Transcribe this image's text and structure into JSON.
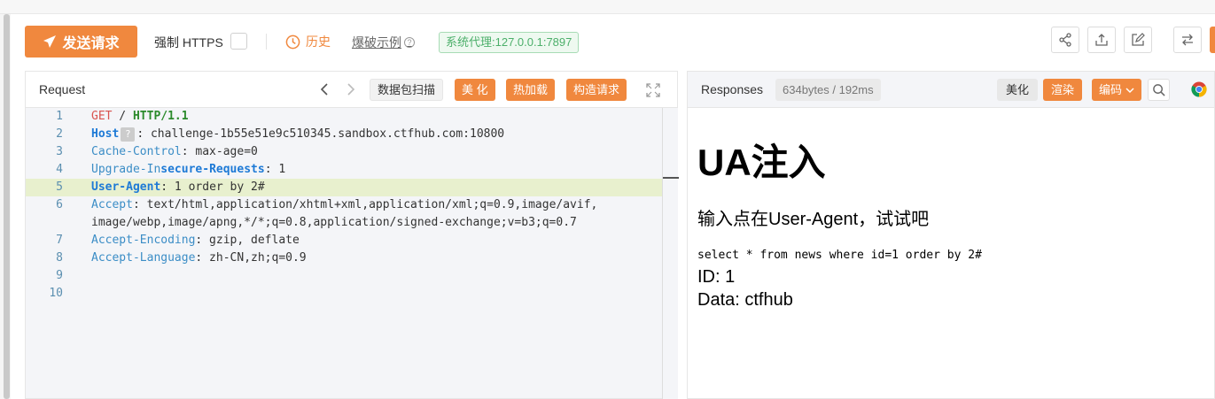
{
  "toolbar": {
    "send_label": "发送请求",
    "https_label": "强制 HTTPS",
    "history_label": "历史",
    "blast_label": "爆破示例",
    "help_mark": "?",
    "proxy_label": "系统代理:127.0.0.1:7897",
    "icons": [
      "share-icon",
      "upload-icon",
      "edit-icon",
      "swap-icon"
    ]
  },
  "request": {
    "title": "Request",
    "scan_label": "数据包扫描",
    "beautify_label": "美 化",
    "hotload_label": "热加载",
    "build_label": "构造请求",
    "lines": [
      {
        "no": "1",
        "parts": [
          [
            "GET",
            "k-red"
          ],
          [
            " / ",
            "dot-sep"
          ],
          [
            "HTTP/1.1",
            "k-green"
          ]
        ]
      },
      {
        "no": "2",
        "parts": [
          [
            "Host",
            "k-blue"
          ],
          [
            "?",
            "qbox"
          ],
          [
            ": challenge-1b55e51e9c510345.sandbox.ctfhub.com:10800",
            ""
          ]
        ]
      },
      {
        "no": "3",
        "parts": [
          [
            "Cache-Control",
            "k-light"
          ],
          [
            ": max-age=0",
            ""
          ]
        ]
      },
      {
        "no": "4",
        "parts": [
          [
            "Upgrade-In",
            "k-light"
          ],
          [
            "secure-Requests",
            "k-blue"
          ],
          [
            ": 1",
            ""
          ]
        ]
      },
      {
        "no": "5",
        "parts": [
          [
            "User-Agent",
            "k-blue"
          ],
          [
            ": 1 order by 2#",
            ""
          ]
        ]
      },
      {
        "no": "6",
        "parts": [
          [
            "Accept",
            "k-light"
          ],
          [
            ": text/html,application/xhtml+xml,application/xml;q=0.9,image/avif,",
            ""
          ]
        ]
      },
      {
        "no": "",
        "parts": [
          [
            "image/webp,image/apng,*/*;q=0.8,application/signed-exchange;v=b3;q=0.7",
            ""
          ]
        ]
      },
      {
        "no": "7",
        "parts": [
          [
            "Accept-Encoding",
            "k-light"
          ],
          [
            ": gzip, deflate",
            ""
          ]
        ]
      },
      {
        "no": "8",
        "parts": [
          [
            "Accept-Language",
            "k-light"
          ],
          [
            ": zh-CN,zh;q=0.9",
            ""
          ]
        ]
      },
      {
        "no": "9",
        "parts": []
      },
      {
        "no": "10",
        "parts": []
      }
    ],
    "highlight_line_index": 4
  },
  "response": {
    "title": "Responses",
    "size_badge": "634bytes / 192ms",
    "beautify_label": "美化",
    "render_label": "渲染",
    "encode_label": "编码",
    "page": {
      "heading": "UA注入",
      "subtitle": "输入点在User-Agent，试试吧",
      "sql": "select * from news where id=1 order by 2#",
      "id_line": "ID: 1",
      "data_line": "Data: ctfhub"
    }
  },
  "colors": {
    "accent": "#f0883e",
    "proxy_green": "#4caf6a",
    "highlight_line": "#e8f0ce"
  }
}
